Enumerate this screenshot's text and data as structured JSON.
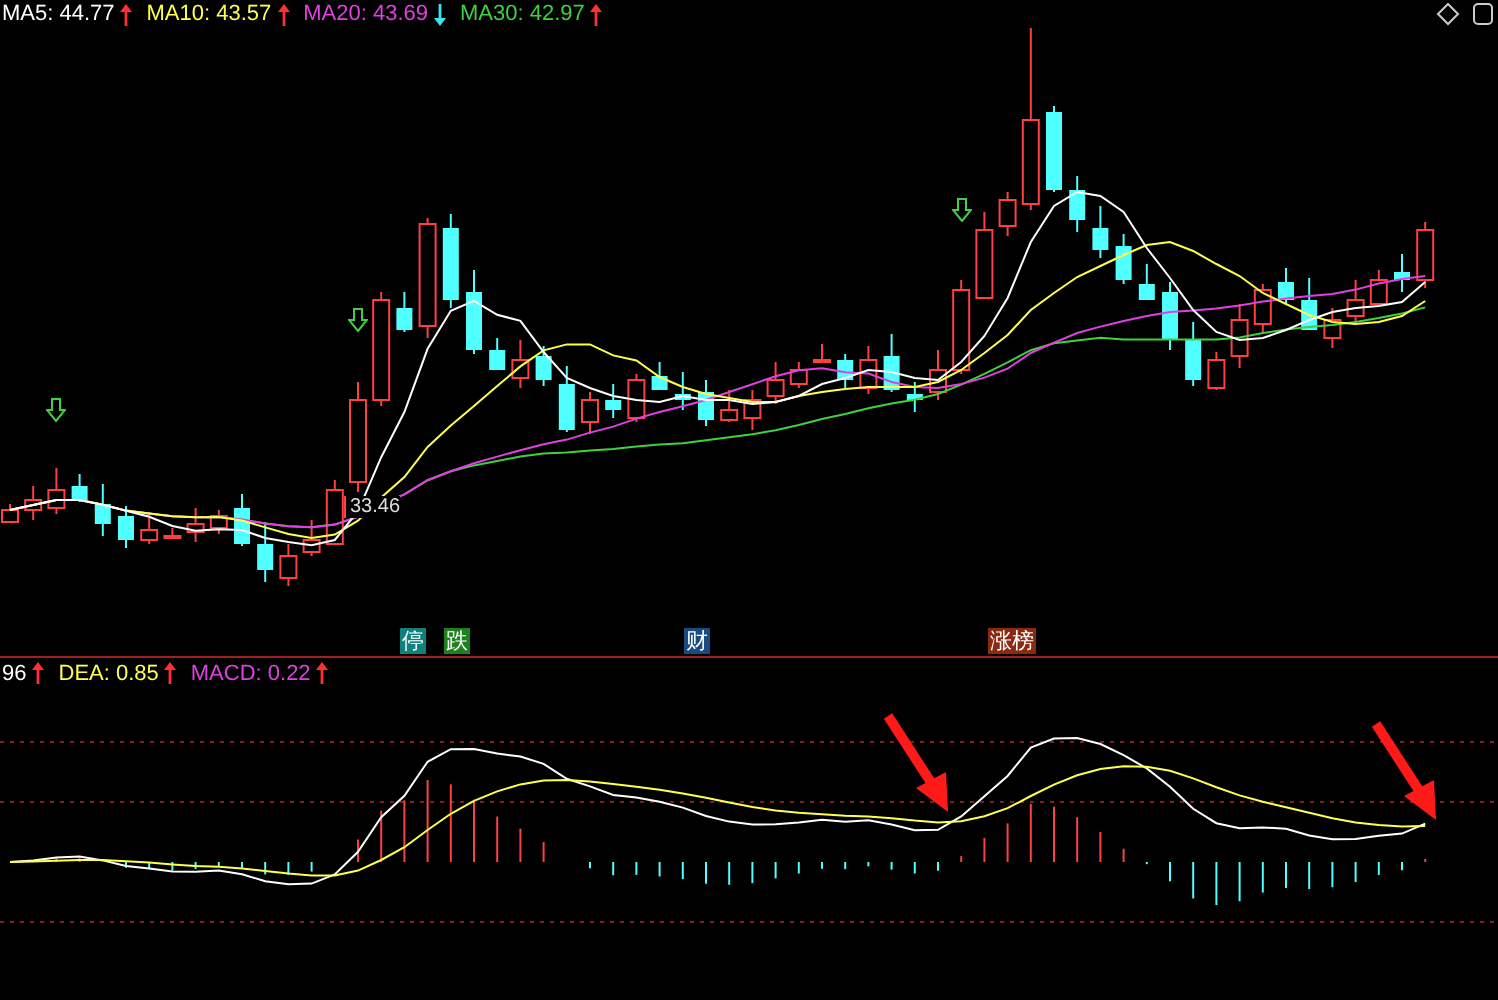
{
  "ma_legend": [
    {
      "label": "MA5: 44.77",
      "rising": true,
      "color": "#ffffff"
    },
    {
      "label": "MA10: 43.57",
      "rising": true,
      "color": "#ffff4d"
    },
    {
      "label": "MA20: 43.69",
      "rising": false,
      "color": "#e040e0"
    },
    {
      "label": "MA30: 42.97",
      "rising": true,
      "color": "#40d040"
    }
  ],
  "low_label": "33.46",
  "event_tags": [
    {
      "label": "停",
      "color": "#10807a"
    },
    {
      "label": "跌",
      "color": "#208020"
    },
    {
      "label": "财",
      "color": "#1a4a80"
    },
    {
      "label": "涨榜",
      "color": "#8a2a10"
    }
  ],
  "macd_legend": [
    {
      "label": "96",
      "rising": true,
      "color": "#ffffff"
    },
    {
      "label": "DEA: 0.85",
      "rising": true,
      "color": "#ffff4d"
    },
    {
      "label": "MACD: 0.22",
      "rising": true,
      "color": "#e040e0"
    }
  ]
}
